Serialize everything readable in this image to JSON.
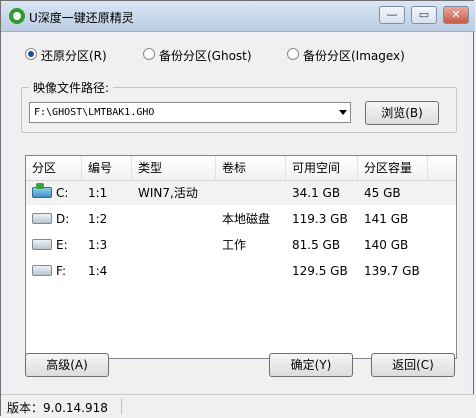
{
  "window": {
    "title": "U深度一键还原精灵",
    "min_label": "—",
    "restore_label": "▭",
    "close_label": "✕"
  },
  "modes": [
    {
      "label": "还原分区(R)",
      "selected": true
    },
    {
      "label": "备份分区(Ghost)",
      "selected": false
    },
    {
      "label": "备份分区(Imagex)",
      "selected": false
    }
  ],
  "image_path": {
    "label": "映像文件路径:",
    "value": "F:\\GHOST\\LMTBAK1.GHO",
    "browse_label": "浏览(B)"
  },
  "table": {
    "columns": [
      "分区",
      "编号",
      "类型",
      "卷标",
      "可用空间",
      "分区容量"
    ],
    "rows": [
      {
        "drive": "C:",
        "icon": "system-drive-icon",
        "number": "1:1",
        "type": "WIN7,活动",
        "volume": "",
        "free": "34.1 GB",
        "size": "45 GB",
        "selected": true
      },
      {
        "drive": "D:",
        "icon": "drive-icon",
        "number": "1:2",
        "type": "",
        "volume": "本地磁盘",
        "free": "119.3 GB",
        "size": "141 GB",
        "selected": false
      },
      {
        "drive": "E:",
        "icon": "drive-icon",
        "number": "1:3",
        "type": "",
        "volume": "工作",
        "free": "81.5 GB",
        "size": "140 GB",
        "selected": false
      },
      {
        "drive": "F:",
        "icon": "drive-icon",
        "number": "1:4",
        "type": "",
        "volume": "",
        "free": "129.5 GB",
        "size": "139.7 GB",
        "selected": false
      }
    ]
  },
  "buttons": {
    "advanced": "高级(A)",
    "confirm": "确定(Y)",
    "back": "返回(C)"
  },
  "status": {
    "version": "版本：9.0.14.918"
  }
}
